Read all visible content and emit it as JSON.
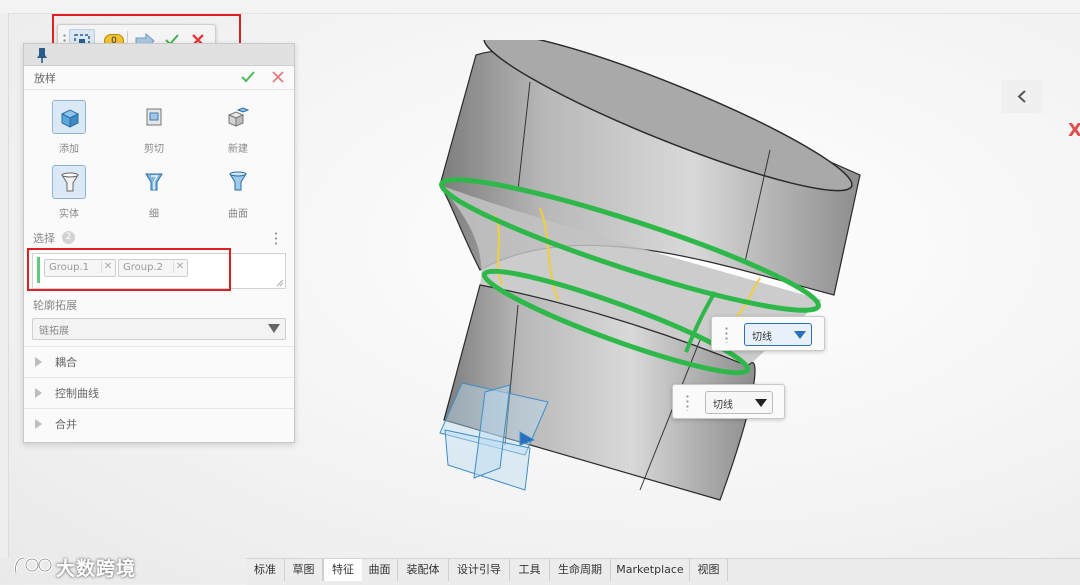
{
  "toolbar": {
    "selection_count": "0"
  },
  "panel": {
    "title": "放样",
    "operations": [
      "添加",
      "剪切",
      "新建"
    ],
    "body_types": [
      "实体",
      "细",
      "曲面"
    ],
    "selection": {
      "label": "选择",
      "count": "2",
      "items": [
        "Group.1",
        "Group.2"
      ]
    },
    "profile": {
      "label": "轮廓拓展",
      "value": "链拓展"
    },
    "sections": [
      "耦合",
      "控制曲线",
      "合并"
    ]
  },
  "viewport": {
    "conditions": [
      {
        "value": "切线"
      },
      {
        "value": "切线"
      }
    ]
  },
  "tabs": [
    "标准",
    "草图",
    "特征",
    "曲面",
    "装配体",
    "设计引导",
    "工具",
    "生命周期",
    "Marketplace",
    "视图"
  ],
  "active_tab": "特征",
  "watermark": "大数跨境",
  "colors": {
    "accent": "#2a6fbf",
    "profile_curve": "#2fb84a",
    "highlight_box": "#e02020",
    "guide_curve": "#f0cf3a"
  }
}
